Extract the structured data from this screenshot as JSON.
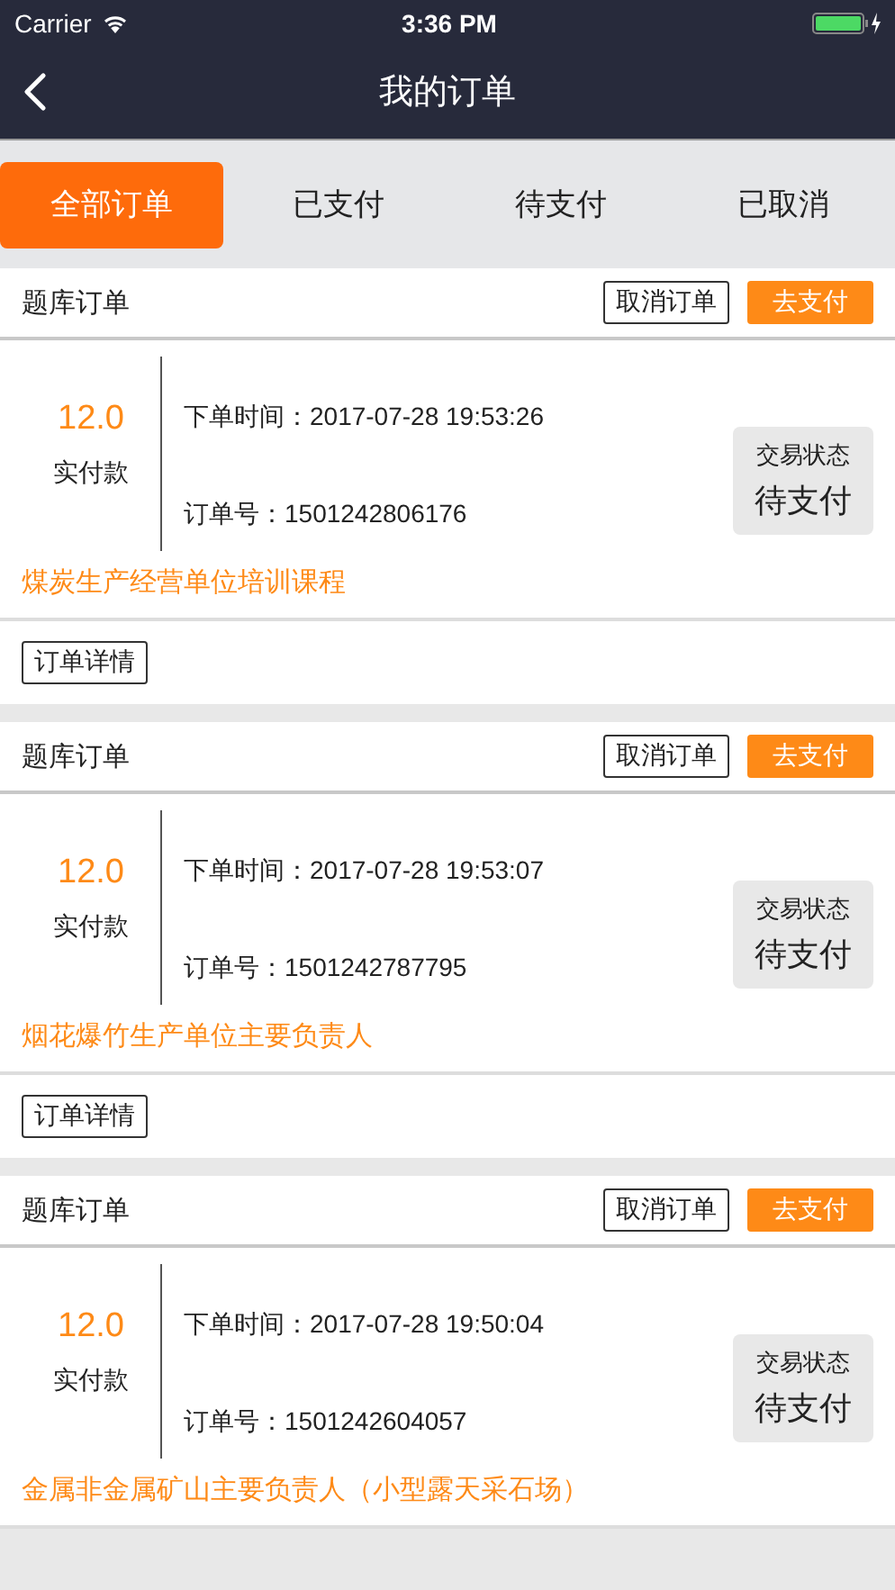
{
  "status_bar": {
    "carrier": "Carrier",
    "time": "3:36 PM"
  },
  "nav": {
    "title": "我的订单"
  },
  "tabs": [
    {
      "label": "全部订单",
      "selected": true
    },
    {
      "label": "已支付",
      "selected": false
    },
    {
      "label": "待支付",
      "selected": false
    },
    {
      "label": "已取消",
      "selected": false
    }
  ],
  "orders": [
    {
      "type": "题库订单",
      "cancel_button": "取消订单",
      "pay_button": "去支付",
      "amount": "12.0",
      "amount_label": "实付款",
      "order_time": "下单时间：2017-07-28 19:53:26",
      "order_number": "订单号：1501242806176",
      "status_label": "交易状态",
      "status": "待支付",
      "course": "煤炭生产经营单位培训课程",
      "detail_button": "订单详情"
    },
    {
      "type": "题库订单",
      "cancel_button": "取消订单",
      "pay_button": "去支付",
      "amount": "12.0",
      "amount_label": "实付款",
      "order_time": "下单时间：2017-07-28 19:53:07",
      "order_number": "订单号：1501242787795",
      "status_label": "交易状态",
      "status": "待支付",
      "course": "烟花爆竹生产单位主要负责人",
      "detail_button": "订单详情"
    },
    {
      "type": "题库订单",
      "cancel_button": "取消订单",
      "pay_button": "去支付",
      "amount": "12.0",
      "amount_label": "实付款",
      "order_time": "下单时间：2017-07-28 19:50:04",
      "order_number": "订单号：1501242604057",
      "status_label": "交易状态",
      "status": "待支付",
      "course": "金属非金属矿山主要负责人（小型露天采石场）"
    }
  ]
}
